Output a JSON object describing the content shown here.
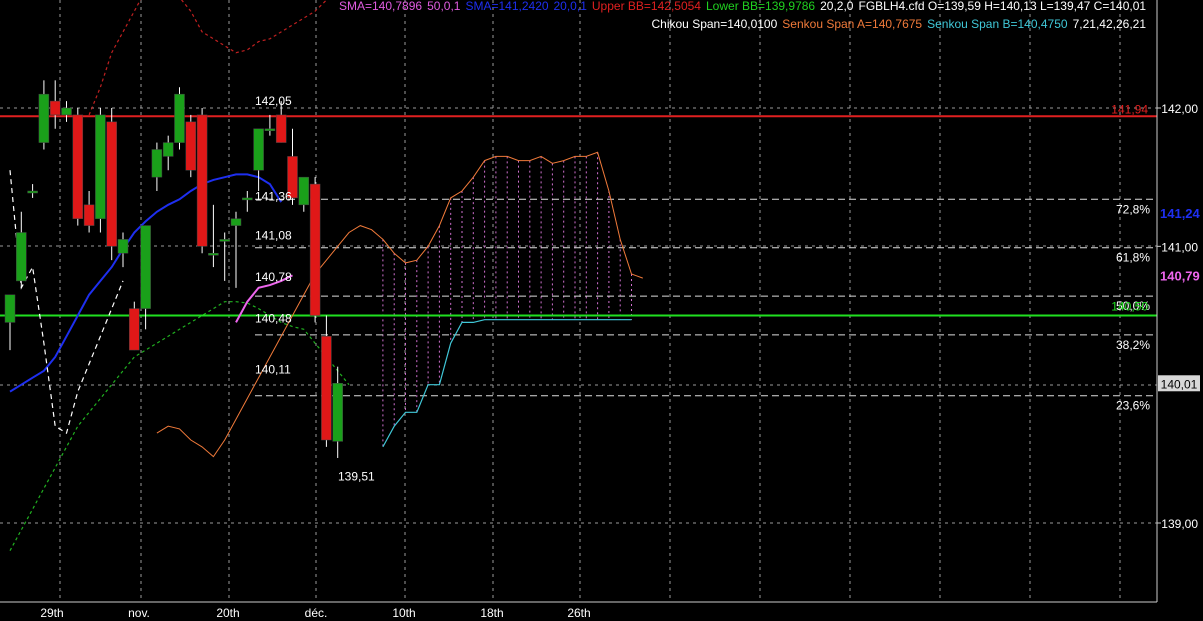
{
  "header": {
    "line1": [
      {
        "text": "SMA=140,7896",
        "color": "#e05ce0"
      },
      {
        "text": "50,0,1",
        "color": "#e05ce0"
      },
      {
        "text": "SMA=141,2420",
        "color": "#1e2ff0"
      },
      {
        "text": "20,0,1",
        "color": "#1e2ff0"
      },
      {
        "text": "Upper BB=142,5054",
        "color": "#e02020"
      },
      {
        "text": "Lower BB=139,9786",
        "color": "#20d020"
      },
      {
        "text": "20,2,0",
        "color": "#ffffff"
      },
      {
        "text": "FGBLH4.cfd O=139,59 H=140,13 L=139,47 C=140,01",
        "color": "#ffffff"
      }
    ],
    "line2": [
      {
        "text": "Chikou Span=140,0100",
        "color": "#ffffff"
      },
      {
        "text": "Senkou Span A=140,7675",
        "color": "#f07a3a"
      },
      {
        "text": "Senkou Span B=140,4750",
        "color": "#40c8d8"
      },
      {
        "text": "7,21,42,26,21",
        "color": "#ffffff"
      }
    ]
  },
  "colors": {
    "background": "#000000",
    "grid": "#9a9a9a",
    "bull_candle": "#1aa01a",
    "bear_candle": "#e01818",
    "wick": "#ffffff",
    "sma20": "#1e2ff0",
    "sma50": "#ee66ee",
    "upper_bb": "#c02020",
    "lower_bb": "#20b020",
    "senkou_a": "#f07a3a",
    "senkou_b": "#40c8d8",
    "cloud_hatch": "#d070d0",
    "chikou": "#ffffff",
    "res_line": "#e02020",
    "sup_line": "#20e020",
    "fib_line": "#dddddd",
    "axis_text": "#ffffff"
  },
  "chart_data": {
    "type": "candlestick",
    "instrument": "FGBLH4.cfd",
    "ylim": [
      138.8,
      142.2
    ],
    "y_ticks": [
      "142,00",
      "141,00",
      "140,00",
      "139,00"
    ],
    "x_ticks": [
      "29th",
      "nov.",
      "20th",
      "déc.",
      "10th",
      "18th",
      "26th"
    ],
    "candles": [
      {
        "o": 140.45,
        "h": 140.65,
        "l": 140.25,
        "c": 140.65
      },
      {
        "o": 140.75,
        "h": 141.25,
        "l": 140.7,
        "c": 141.1
      },
      {
        "o": 141.4,
        "h": 141.45,
        "l": 141.35,
        "c": 141.4
      },
      {
        "o": 141.75,
        "h": 142.2,
        "l": 141.7,
        "c": 142.1
      },
      {
        "o": 142.05,
        "h": 142.2,
        "l": 141.85,
        "c": 141.95
      },
      {
        "o": 141.95,
        "h": 142.05,
        "l": 141.9,
        "c": 142.0
      },
      {
        "o": 141.95,
        "h": 142.0,
        "l": 141.15,
        "c": 141.2
      },
      {
        "o": 141.3,
        "h": 141.4,
        "l": 141.1,
        "c": 141.15
      },
      {
        "o": 141.2,
        "h": 142.0,
        "l": 141.1,
        "c": 141.95
      },
      {
        "o": 141.9,
        "h": 142.0,
        "l": 140.9,
        "c": 141.0
      },
      {
        "o": 140.95,
        "h": 141.1,
        "l": 140.85,
        "c": 141.05
      },
      {
        "o": 140.55,
        "h": 140.6,
        "l": 140.25,
        "c": 140.25
      },
      {
        "o": 140.55,
        "h": 141.15,
        "l": 140.4,
        "c": 141.15
      },
      {
        "o": 141.5,
        "h": 141.75,
        "l": 141.4,
        "c": 141.7
      },
      {
        "o": 141.65,
        "h": 141.8,
        "l": 141.55,
        "c": 141.75
      },
      {
        "o": 141.75,
        "h": 142.15,
        "l": 141.7,
        "c": 142.1
      },
      {
        "o": 141.9,
        "h": 141.95,
        "l": 141.5,
        "c": 141.55
      },
      {
        "o": 141.95,
        "h": 142.0,
        "l": 140.95,
        "c": 141.0
      },
      {
        "o": 140.95,
        "h": 141.3,
        "l": 140.85,
        "c": 140.95
      },
      {
        "o": 141.05,
        "h": 141.1,
        "l": 140.75,
        "c": 141.05
      },
      {
        "o": 141.15,
        "h": 141.25,
        "l": 140.7,
        "c": 141.2
      },
      {
        "o": 141.35,
        "h": 141.4,
        "l": 141.25,
        "c": 141.35
      },
      {
        "o": 141.55,
        "h": 141.8,
        "l": 141.4,
        "c": 141.85
      },
      {
        "o": 141.85,
        "h": 141.95,
        "l": 141.8,
        "c": 141.85
      },
      {
        "o": 141.95,
        "h": 142.05,
        "l": 141.75,
        "c": 141.75
      },
      {
        "o": 141.65,
        "h": 141.85,
        "l": 141.3,
        "c": 141.35
      },
      {
        "o": 141.3,
        "h": 141.45,
        "l": 141.25,
        "c": 141.5
      },
      {
        "o": 141.45,
        "h": 141.5,
        "l": 140.45,
        "c": 140.5
      },
      {
        "o": 140.35,
        "h": 140.5,
        "l": 139.55,
        "c": 139.6
      },
      {
        "o": 139.59,
        "h": 140.13,
        "l": 139.47,
        "c": 140.01
      }
    ],
    "sma20": [
      139.95,
      140.0,
      140.05,
      140.1,
      140.2,
      140.35,
      140.5,
      140.65,
      140.75,
      140.85,
      140.98,
      141.1,
      141.18,
      141.25,
      141.3,
      141.34,
      141.4,
      141.45,
      141.48,
      141.5,
      141.52,
      141.52,
      141.5,
      141.45,
      141.32
    ],
    "sma50": [
      140.45,
      140.6,
      140.7,
      140.72,
      140.75,
      140.79
    ],
    "upper_bb": [
      141.95,
      142.15,
      142.4,
      142.55,
      142.7,
      142.85,
      142.9,
      142.85,
      142.8,
      142.7,
      142.55,
      142.5,
      142.45,
      142.4,
      142.42,
      142.48,
      142.5,
      142.55,
      142.6,
      142.65,
      142.7,
      142.78,
      142.85,
      142.95,
      143.1,
      143.3,
      143.35,
      143.4,
      143.45,
      143.55,
      143.8
    ],
    "lower_bb": [
      138.8,
      138.95,
      139.1,
      139.25,
      139.4,
      139.55,
      139.7,
      139.8,
      139.9,
      140.0,
      140.1,
      140.2,
      140.25,
      140.3,
      140.35,
      140.4,
      140.45,
      140.5,
      140.55,
      140.6,
      140.6,
      140.59,
      140.55,
      140.5,
      140.45,
      140.42,
      140.4,
      140.3,
      140.2,
      140.1,
      140.0
    ],
    "senkou_a": [
      139.65,
      139.7,
      139.68,
      139.6,
      139.55,
      139.48,
      139.6,
      139.75,
      139.9,
      140.05,
      140.2,
      140.35,
      140.5,
      140.65,
      140.8,
      140.9,
      141.0,
      141.1,
      141.15,
      141.12,
      141.05,
      140.95,
      140.88,
      140.9,
      141.0,
      141.15,
      141.35,
      141.4,
      141.5,
      141.62,
      141.65,
      141.65,
      141.62,
      141.62,
      141.65,
      141.6,
      141.62,
      141.65,
      141.65,
      141.68,
      141.4,
      141.05,
      140.8,
      140.77
    ],
    "senkou_b": [
      139.55,
      139.7,
      139.8,
      139.8,
      140.0,
      140.0,
      140.3,
      140.45,
      140.45,
      140.47,
      140.47,
      140.47,
      140.47,
      140.47,
      140.47,
      140.47,
      140.47,
      140.47,
      140.47,
      140.47,
      140.47,
      140.47,
      140.47
    ],
    "chikou": [
      141.55,
      140.7,
      140.85,
      140.3,
      139.7,
      139.65,
      139.95,
      140.15,
      140.35,
      140.55,
      140.75
    ],
    "resistance_line": {
      "value": 141.94,
      "label": "141,94"
    },
    "support_line": {
      "value": 140.5,
      "label": "140,50"
    },
    "fibonacci": [
      {
        "value": 141.34,
        "label": "72,8%"
      },
      {
        "value": 140.99,
        "label": "61,8%"
      },
      {
        "value": 140.64,
        "label": "50,0%"
      },
      {
        "value": 140.36,
        "label": "38,2%"
      },
      {
        "value": 139.92,
        "label": "23,6%"
      }
    ],
    "price_annotations": [
      {
        "label": "142,05",
        "value": 142.05
      },
      {
        "label": "141,36",
        "value": 141.36
      },
      {
        "label": "141,08",
        "value": 141.08
      },
      {
        "label": "140,78",
        "value": 140.78
      },
      {
        "label": "140,48",
        "value": 140.48
      },
      {
        "label": "140,11",
        "value": 140.11
      },
      {
        "label": "139,51",
        "value": 139.51
      }
    ],
    "axis_markers": [
      {
        "label": "141,24",
        "value": 141.24,
        "color": "#1e2ff0"
      },
      {
        "label": "140,79",
        "value": 140.79,
        "color": "#ee66ee"
      },
      {
        "label": "140,01",
        "value": 140.01,
        "color": "#ffffff"
      }
    ]
  }
}
